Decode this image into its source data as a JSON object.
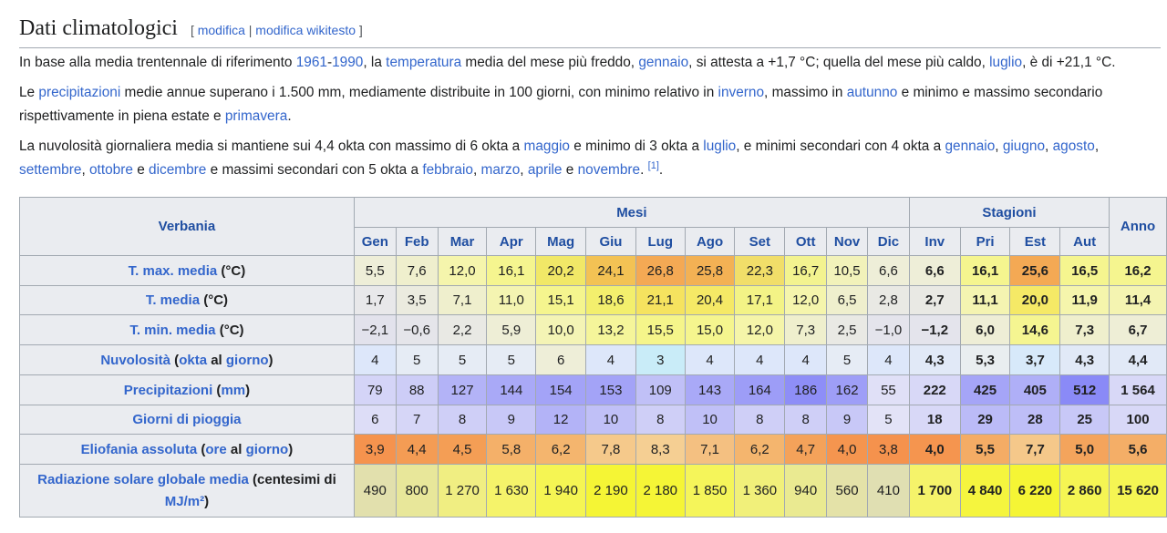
{
  "section": {
    "title": "Dati climatologici",
    "edit_open": "[ ",
    "edit_link": "modifica",
    "edit_sep": " | ",
    "edit_source_link": "modifica wikitesto",
    "edit_close": " ]"
  },
  "paragraphs": [
    [
      {
        "t": "In base alla media trentennale di riferimento "
      },
      {
        "t": "1961",
        "l": true
      },
      {
        "t": "-"
      },
      {
        "t": "1990",
        "l": true
      },
      {
        "t": ", la "
      },
      {
        "t": "temperatura",
        "l": true
      },
      {
        "t": " media del mese più freddo, "
      },
      {
        "t": "gennaio",
        "l": true
      },
      {
        "t": ", si attesta a +1,7 °C; quella del mese più caldo, "
      },
      {
        "t": "luglio",
        "l": true
      },
      {
        "t": ", è di +21,1 °C."
      }
    ],
    [
      {
        "t": "Le "
      },
      {
        "t": "precipitazioni",
        "l": true
      },
      {
        "t": " medie annue superano i 1.500 mm, mediamente distribuite in 100 giorni, con minimo relativo in "
      },
      {
        "t": "inverno",
        "l": true
      },
      {
        "t": ", massimo in "
      },
      {
        "t": "autunno",
        "l": true
      },
      {
        "t": " e minimo e massimo secondario rispettivamente in piena estate e "
      },
      {
        "t": "primavera",
        "l": true
      },
      {
        "t": "."
      }
    ],
    [
      {
        "t": "La nuvolosità giornaliera media si mantiene sui 4,4 okta con massimo di 6 okta a "
      },
      {
        "t": "maggio",
        "l": true
      },
      {
        "t": " e minimo di 3 okta a "
      },
      {
        "t": "luglio",
        "l": true
      },
      {
        "t": ", e minimi secondari con 4 okta a "
      },
      {
        "t": "gennaio",
        "l": true
      },
      {
        "t": ", "
      },
      {
        "t": "giugno",
        "l": true
      },
      {
        "t": ", "
      },
      {
        "t": "agosto",
        "l": true
      },
      {
        "t": ", "
      },
      {
        "t": "settembre",
        "l": true
      },
      {
        "t": ", "
      },
      {
        "t": "ottobre",
        "l": true
      },
      {
        "t": " e "
      },
      {
        "t": "dicembre",
        "l": true
      },
      {
        "t": " e massimi secondari con 5 okta a "
      },
      {
        "t": "febbraio",
        "l": true
      },
      {
        "t": ", "
      },
      {
        "t": "marzo",
        "l": true
      },
      {
        "t": ", "
      },
      {
        "t": "aprile",
        "l": true
      },
      {
        "t": " e "
      },
      {
        "t": "novembre",
        "l": true
      },
      {
        "t": ". "
      },
      {
        "t": "[1]",
        "l": true,
        "sup": true
      },
      {
        "t": "."
      }
    ]
  ],
  "table": {
    "corner": "Verbania",
    "group_months": "Mesi",
    "group_seasons": "Stagioni",
    "year_header": "Anno",
    "months": [
      "Gen",
      "Feb",
      "Mar",
      "Apr",
      "Mag",
      "Giu",
      "Lug",
      "Ago",
      "Set",
      "Ott",
      "Nov",
      "Dic"
    ],
    "seasons": [
      "Inv",
      "Pri",
      "Est",
      "Aut"
    ],
    "rows": [
      {
        "label": [
          {
            "t": "T. max. media",
            "l": true
          },
          {
            "t": " (°C)"
          }
        ],
        "months": [
          "5,5",
          "7,6",
          "12,0",
          "16,1",
          "20,2",
          "24,1",
          "26,8",
          "25,8",
          "22,3",
          "16,7",
          "10,5",
          "6,6"
        ],
        "seasons": [
          "6,6",
          "16,1",
          "25,6",
          "16,5"
        ],
        "year": "16,2",
        "month_colors": [
          "#eeeed8",
          "#efefcd",
          "#f5f5ac",
          "#f5f58f",
          "#f1e867",
          "#f3c254",
          "#f4a954",
          "#f3b154",
          "#f1de69",
          "#f3f38f",
          "#f2f2ba",
          "#eeeed8"
        ],
        "season_colors": [
          "#eeeed8",
          "#f5f58f",
          "#f4a954",
          "#f5f58f"
        ],
        "year_color": "#f5f58f"
      },
      {
        "label": [
          {
            "t": "T. media",
            "l": true
          },
          {
            "t": " (°C)"
          }
        ],
        "months": [
          "1,7",
          "3,5",
          "7,1",
          "11,0",
          "15,1",
          "18,6",
          "21,1",
          "20,4",
          "17,1",
          "12,0",
          "6,5",
          "2,8"
        ],
        "seasons": [
          "2,7",
          "11,1",
          "20,0",
          "11,9"
        ],
        "year": "11,4",
        "month_colors": [
          "#e8e8ea",
          "#ebebdf",
          "#efefcd",
          "#f4f4b1",
          "#f5f58e",
          "#f3ef6d",
          "#f5e35f",
          "#f5e966",
          "#f3f386",
          "#f5f5ac",
          "#efefcd",
          "#e9e9e4"
        ],
        "season_colors": [
          "#e9e9e4",
          "#f4f4b1",
          "#f5e966",
          "#f5f5ac"
        ],
        "year_color": "#f4f4b1"
      },
      {
        "label": [
          {
            "t": "T. min. media",
            "l": true
          },
          {
            "t": " (°C)"
          }
        ],
        "months": [
          "−2,1",
          "−0,6",
          "2,2",
          "5,9",
          "10,0",
          "13,2",
          "15,5",
          "15,0",
          "12,0",
          "7,3",
          "2,5",
          "−1,0"
        ],
        "seasons": [
          "−1,2",
          "6,0",
          "14,6",
          "7,3"
        ],
        "year": "6,7",
        "month_colors": [
          "#e2e2ec",
          "#e5e5ea",
          "#e9e9e4",
          "#eeeed6",
          "#f4f4b5",
          "#f5f59a",
          "#f5f58a",
          "#f5f58e",
          "#f5f5a9",
          "#efefcd",
          "#e9e9e4",
          "#e4e4ec"
        ],
        "season_colors": [
          "#e4e4ec",
          "#eeeed6",
          "#f5f591",
          "#efefcd"
        ],
        "year_color": "#eeeed6"
      },
      {
        "label": [
          {
            "t": "Nuvolosità",
            "l": true
          },
          {
            "t": " ("
          },
          {
            "t": "okta",
            "l": true
          },
          {
            "t": " al "
          },
          {
            "t": "giorno",
            "l": true
          },
          {
            "t": ")"
          }
        ],
        "months": [
          "4",
          "5",
          "5",
          "5",
          "6",
          "4",
          "3",
          "4",
          "4",
          "4",
          "5",
          "4"
        ],
        "seasons": [
          "4,3",
          "5,3",
          "3,7",
          "4,3"
        ],
        "year": "4,4",
        "month_colors": [
          "#dde7fa",
          "#e6ecf5",
          "#e6ecf5",
          "#e6ecf5",
          "#eeeed8",
          "#dde7fa",
          "#c9ecf8",
          "#dde7fa",
          "#dde7fa",
          "#dde7fa",
          "#e6ecf5",
          "#dde7fa"
        ],
        "season_colors": [
          "#e1e9f7",
          "#e9eef0",
          "#d7e9fa",
          "#e1e9f7"
        ],
        "year_color": "#e1e9f7"
      },
      {
        "label": [
          {
            "t": "Precipitazioni",
            "l": true
          },
          {
            "t": " ("
          },
          {
            "t": "mm",
            "l": true
          },
          {
            "t": ")"
          }
        ],
        "months": [
          "79",
          "88",
          "127",
          "144",
          "154",
          "153",
          "109",
          "143",
          "164",
          "186",
          "162",
          "55"
        ],
        "seasons": [
          "222",
          "425",
          "405",
          "512"
        ],
        "year": "1 564",
        "month_colors": [
          "#d4d4f7",
          "#cdcdf7",
          "#b3b3f7",
          "#a9a9f7",
          "#a3a3f7",
          "#a3a3f7",
          "#c0c0f7",
          "#a9a9f7",
          "#9d9df7",
          "#8e8ef7",
          "#9e9ef7",
          "#e0e0f7"
        ],
        "season_colors": [
          "#d8d8f7",
          "#a5a5f7",
          "#afaff7",
          "#8a8af7"
        ],
        "year_color": "#d8d8f7"
      },
      {
        "label": [
          {
            "t": "Giorni di pioggia",
            "l": true
          }
        ],
        "months": [
          "6",
          "7",
          "8",
          "9",
          "12",
          "10",
          "8",
          "10",
          "8",
          "8",
          "9",
          "5"
        ],
        "seasons": [
          "18",
          "29",
          "28",
          "25"
        ],
        "year": "100",
        "month_colors": [
          "#ddddf7",
          "#d6d6f7",
          "#cfcff7",
          "#c8c8f7",
          "#b3b3f7",
          "#c0c0f7",
          "#cfcff7",
          "#c0c0f7",
          "#cfcff7",
          "#cfcff7",
          "#c8c8f7",
          "#e3e3f7"
        ],
        "season_colors": [
          "#d8d8f7",
          "#bbbbf7",
          "#bebef7",
          "#c8c8f7"
        ],
        "year_color": "#d8d8f7"
      },
      {
        "label": [
          {
            "t": "Eliofania assoluta",
            "l": true
          },
          {
            "t": " ("
          },
          {
            "t": "ore",
            "l": true
          },
          {
            "t": " al "
          },
          {
            "t": "giorno",
            "l": true
          },
          {
            "t": ")"
          }
        ],
        "months": [
          "3,9",
          "4,4",
          "4,5",
          "5,8",
          "6,2",
          "7,8",
          "8,3",
          "7,1",
          "6,2",
          "4,7",
          "4,0",
          "3,8"
        ],
        "seasons": [
          "4,0",
          "5,5",
          "7,7",
          "5,0"
        ],
        "year": "5,6",
        "month_colors": [
          "#f5934e",
          "#f49c54",
          "#f49e55",
          "#f4b069",
          "#f4b56e",
          "#f5c98b",
          "#f5cf93",
          "#f4c081",
          "#f4b56e",
          "#f4a25a",
          "#f5954f",
          "#f5924d"
        ],
        "season_colors": [
          "#f5954f",
          "#f4ac65",
          "#f5c88a",
          "#f4a45c"
        ],
        "year_color": "#f4ae67"
      },
      {
        "label": [
          {
            "t": "Radiazione solare globale media",
            "l": true
          },
          {
            "t": " (centesimi di "
          },
          {
            "t": "MJ/m²",
            "l": true
          },
          {
            "t": ")"
          }
        ],
        "months": [
          "490",
          "800",
          "1 270",
          "1 630",
          "1 940",
          "2 190",
          "2 180",
          "1 850",
          "1 360",
          "940",
          "560",
          "410"
        ],
        "seasons": [
          "1 700",
          "4 840",
          "6 220",
          "2 860"
        ],
        "year": "15 620",
        "month_colors": [
          "#e2e0ad",
          "#e8e79a",
          "#f0ee82",
          "#f5f36a",
          "#f5f553",
          "#f5f535",
          "#f5f536",
          "#f5f55a",
          "#f1f07a",
          "#eaea91",
          "#e4e2a8",
          "#e0dfb2"
        ],
        "season_colors": [
          "#f5f36a",
          "#f5f53e",
          "#f5f535",
          "#f5f553"
        ],
        "year_color": "#f5f553"
      }
    ]
  }
}
